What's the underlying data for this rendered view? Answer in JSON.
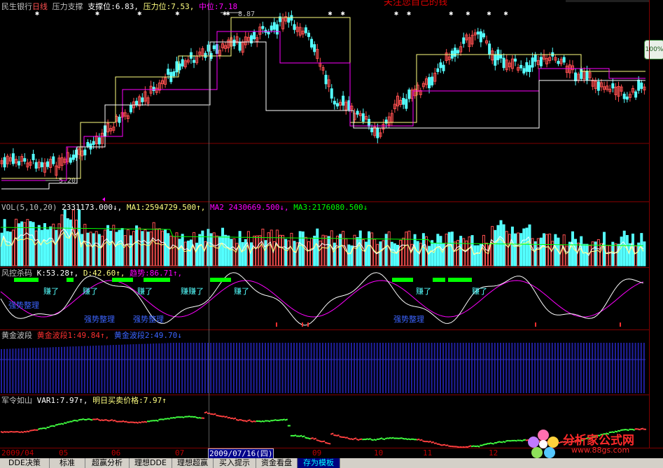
{
  "top_title": "关注您自己的钱",
  "main_pane": {
    "stock": "民生银行",
    "period": "日线",
    "indicator": "压力支撑",
    "support_label": "支撑位:",
    "support_value": "6.83,",
    "pressure_label": "压力位:",
    "pressure_value": "7.53,",
    "mid_label": "中位:",
    "mid_value": "7.18",
    "high_mark": "8.87",
    "low_mark": "5.20"
  },
  "vol_pane": {
    "name": "VOL(5,10,20)",
    "vol_value": "2331173.000↓,",
    "ma1_label": "MA1:",
    "ma1_value": "2594729.500↑,",
    "ma2_label": "MA2",
    "ma2_value": "2430669.500↓,",
    "ma3_label": "MA3:",
    "ma3_value": "2176080.500↓"
  },
  "kdj_pane": {
    "name": "风控杀码",
    "k_label": "K:",
    "k_value": "53.28↑,",
    "d_label": "D:",
    "d_value": "42.60↑,",
    "trend_label": "趋势:",
    "trend_value": "86.71↑,",
    "earn_labels": [
      "赚了",
      "赚了",
      "赚了",
      "赚赚了",
      "赚了",
      "赚了",
      "赚了"
    ],
    "consolidate_labels": [
      "强势整理",
      "强势整理",
      "强势整理",
      "强势整理"
    ]
  },
  "wave_pane": {
    "name": "黄金波段",
    "wave1_label": "黄金波段1:",
    "wave1_value": "49.84↑,",
    "wave2_label": "黄金波段2:",
    "wave2_value": "49.70↓"
  },
  "army_pane": {
    "name": "军令如山",
    "var1_label": "VAR1:",
    "var1_value": "7.97↑,",
    "price_label": "明日买卖价格:",
    "price_value": "7.97↑"
  },
  "date_axis": {
    "labels": [
      "2009/04",
      "05",
      "06",
      "07",
      "09",
      "10",
      "11",
      "12"
    ],
    "selected_date": "2009/07/16(四)"
  },
  "tabs": [
    "DDE决策",
    "标准",
    "超赢分析",
    "理想DDE",
    "理想超赢",
    "买入提示",
    "资金看盘",
    "存为模板"
  ],
  "active_tab": "存为模板",
  "zoom_label": "100%",
  "logo": {
    "text": "分析家公式网",
    "url": "www.88gs.com"
  },
  "colors": {
    "up": "#ff5050",
    "down": "#54ffff",
    "axis": "#800000",
    "support_line": "#ffff80",
    "pressure_line": "#ff00ff",
    "mid_line": "#ffffff",
    "k_line": "#ffffff",
    "d_line": "#ff00ff",
    "wave_bar": "#2020a0",
    "signal_bar": "#00ff00"
  }
}
